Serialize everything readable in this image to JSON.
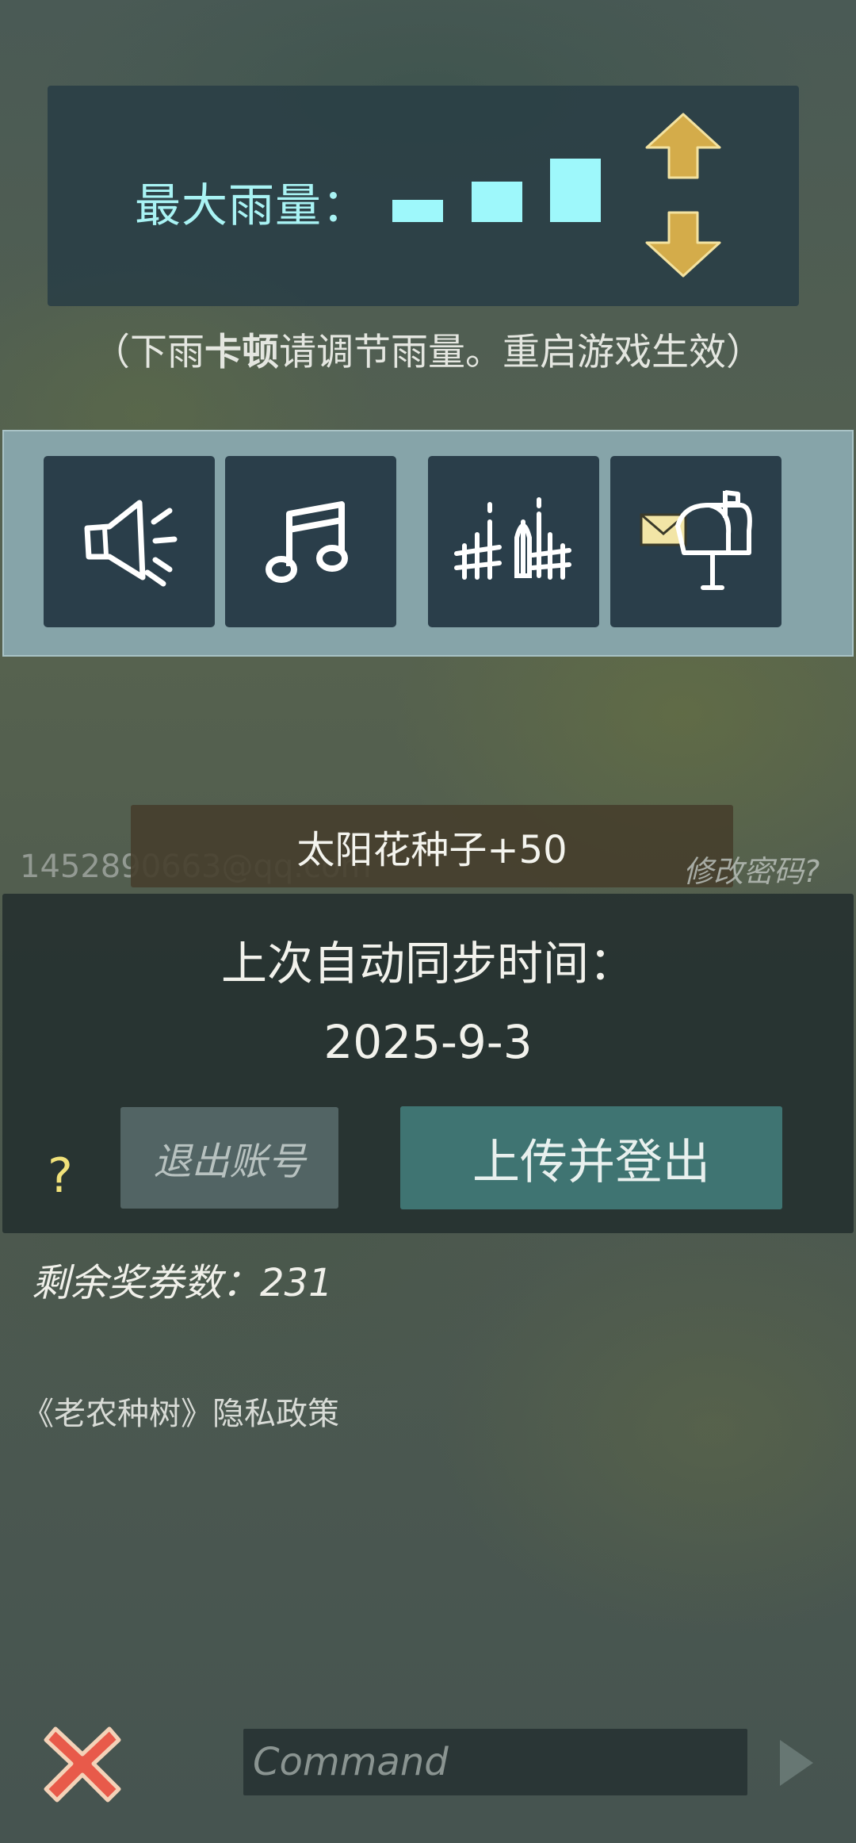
{
  "rain": {
    "label": "最大雨量：",
    "note_prefix": "（下雨",
    "note_bold": "卡顿",
    "note_suffix": "请调节雨量。重启游戏生效）",
    "level_count": 3,
    "bar_color": "#9ef8fb",
    "arrow_color": "#d4ac4a"
  },
  "settings": {
    "icons": [
      "speaker-icon",
      "music-note-icon",
      "fence-icon",
      "mailbox-icon"
    ],
    "tile_color": "#2a3e4a",
    "bar_color": "#86a4a9"
  },
  "account": {
    "toast": "太阳花种子+50",
    "email": "1452890663@qq.com",
    "change_password": "修改密码?",
    "sync_title": "上次自动同步时间：",
    "sync_date": "2025-9-3",
    "help": "?",
    "logout_label": "退出账号",
    "upload_label": "上传并登出",
    "tickets": "剩余奖券数：231",
    "privacy": "《老农种树》隐私政策"
  },
  "command": {
    "placeholder": "Command"
  },
  "colors": {
    "close_red": "#e85a4a",
    "upload_green": "#3f7472",
    "help_yellow": "#f1e27a"
  }
}
